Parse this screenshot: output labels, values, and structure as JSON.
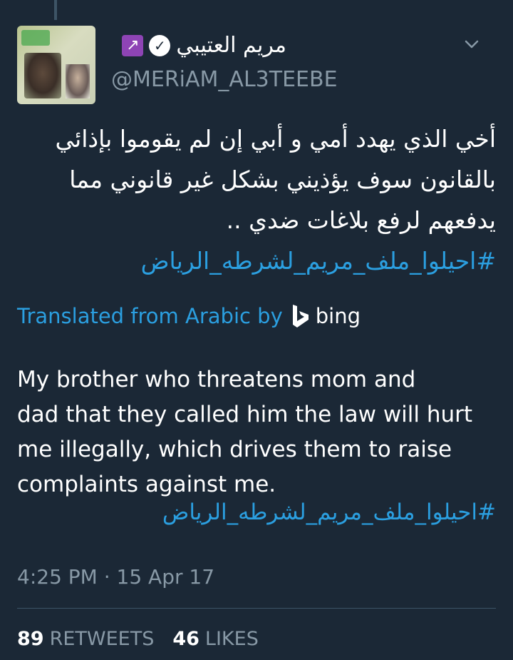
{
  "tweet": {
    "display_name": "مريم العتيبي",
    "verified_icon": "verified-badge-icon",
    "name_emoji": "sagittarius-icon",
    "handle": "@MERiAM_AL3TEEBE",
    "arabic_lines": [
      "أخي الذي يهدد أمي و أبي إن لم يقوموا بإذائي",
      "بالقانون سوف يؤذيني بشكل غير قانوني مما",
      "يدفعهم لرفع بلاغات ضدي .."
    ],
    "hashtag": "#احيلوا_ملف_مريم_لشرطه_الرياض",
    "translated_label": "Translated from Arabic by",
    "translator": "bing",
    "english_lines": [
      "My brother who threatens mom and",
      "dad that they called him the law will hurt",
      "me illegally, which drives them to raise",
      "complaints against me."
    ],
    "hashtag_translated": "#احيلوا_ملف_مريم_لشرطه_الرياض",
    "timestamp": "4:25 PM · 15 Apr 17",
    "retweets_count": "89",
    "retweets_label": "RETWEETS",
    "likes_count": "46",
    "likes_label": "LIKES"
  },
  "colors": {
    "background": "#1b2836",
    "link": "#2b9fe0",
    "muted": "#8899a6"
  }
}
